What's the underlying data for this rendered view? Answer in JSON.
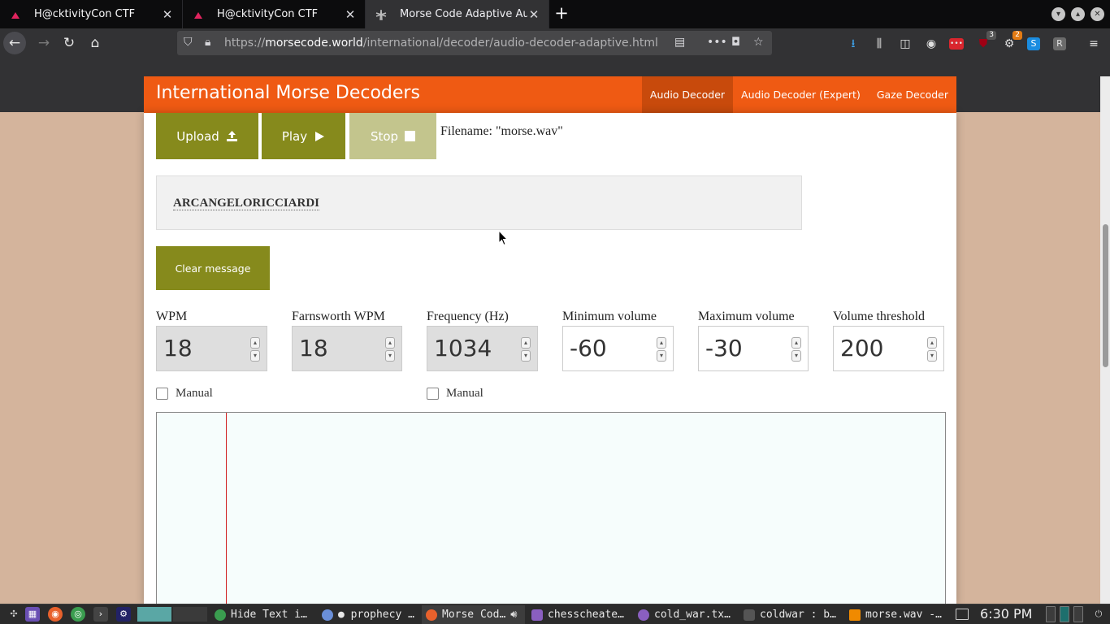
{
  "browser": {
    "tabs": [
      {
        "title": "H@cktivityCon CTF",
        "active": false
      },
      {
        "title": "H@cktivityCon CTF",
        "active": false
      },
      {
        "title": "Morse Code Adaptive Aud",
        "active": true
      }
    ],
    "url_prefix": "https://",
    "url_host": "morsecode.world",
    "url_path": "/international/decoder/audio-decoder-adaptive.html",
    "toolbar_badges": {
      "ublock": "3",
      "ext": "2"
    }
  },
  "site": {
    "title": "International Morse Decoders",
    "nav": [
      {
        "label": "Audio Decoder",
        "active": true
      },
      {
        "label": "Audio Decoder (Expert)",
        "active": false
      },
      {
        "label": "Gaze Decoder",
        "active": false
      }
    ]
  },
  "controls": {
    "upload_label": "Upload",
    "play_label": "Play",
    "stop_label": "Stop",
    "filename_text": "Filename: \"morse.wav\""
  },
  "message": {
    "text": "ARCANGELORICCIARDI",
    "clear_label": "Clear message"
  },
  "settings": [
    {
      "label": "WPM",
      "value": "18",
      "disabled": true
    },
    {
      "label": "Farnsworth WPM",
      "value": "18",
      "disabled": true
    },
    {
      "label": "Frequency (Hz)",
      "value": "1034",
      "disabled": true
    },
    {
      "label": "Minimum volume",
      "value": "-60",
      "disabled": false
    },
    {
      "label": "Maximum volume",
      "value": "-30",
      "disabled": false
    },
    {
      "label": "Volume threshold",
      "value": "200",
      "disabled": false
    }
  ],
  "checkboxes": [
    {
      "label": "Manual",
      "checked": false
    },
    {
      "label": "Manual",
      "checked": false
    }
  ],
  "taskbar": {
    "tasks": [
      {
        "label": "Hide Text i…",
        "active": false
      },
      {
        "label": "● prophecy …",
        "active": false
      },
      {
        "label": "Morse Cod…",
        "active": true
      },
      {
        "label": "chesscheate…",
        "active": false
      },
      {
        "label": "cold_war.tx…",
        "active": false
      },
      {
        "label": "coldwar : b…",
        "active": false
      },
      {
        "label": "morse.wav -…",
        "active": false
      }
    ],
    "clock": "6:30 PM"
  },
  "colors": {
    "header_orange": "#ef5a13",
    "button_olive": "#868a1c",
    "button_disabled": "#c3c58d",
    "scope_marker": "#d02020"
  }
}
